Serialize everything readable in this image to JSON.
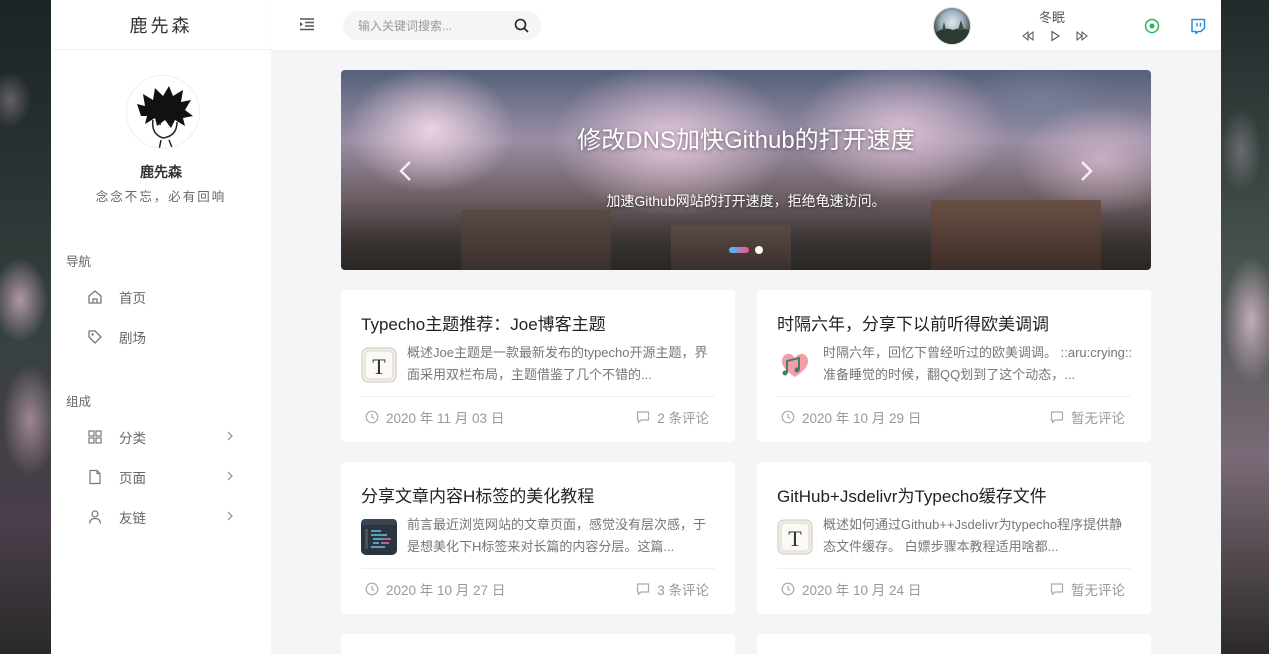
{
  "site": {
    "brand": "鹿先森"
  },
  "profile": {
    "name": "鹿先森",
    "motto": "念念不忘，必有回响"
  },
  "nav": {
    "title": "导航",
    "items": [
      {
        "label": "首页",
        "icon": "home-icon"
      },
      {
        "label": "剧场",
        "icon": "tag-icon"
      }
    ]
  },
  "compose": {
    "title": "组成",
    "items": [
      {
        "label": "分类",
        "icon": "grid-icon"
      },
      {
        "label": "页面",
        "icon": "file-icon"
      },
      {
        "label": "友链",
        "icon": "user-icon"
      }
    ]
  },
  "header": {
    "search_placeholder": "输入关键词搜索...",
    "music_title": "冬眠",
    "colors": {
      "accent_green": "#29b555",
      "accent_blue": "#2a8bd8"
    }
  },
  "banner": {
    "title": "修改DNS加快Github的打开速度",
    "subtitle": "加速Github网站的打开速度，拒绝龟速访问。"
  },
  "posts": [
    {
      "title": "Typecho主题推荐：Joe博客主题",
      "excerpt": "概述Joe主题是一款最新发布的typecho开源主题，界面采用双栏布局，主题借鉴了几个不错的...",
      "date": "2020 年 11 月 03 日",
      "comments": "2 条评论",
      "thumb": "typora-t-icon"
    },
    {
      "title": "时隔六年，分享下以前听得欧美调调",
      "excerpt": "时隔六年，回忆下曾经听过的欧美调调。 ::aru:crying:: 准备睡觉的时候，翻QQ划到了这个动态，...",
      "date": "2020 年 10 月 29 日",
      "comments": "暂无评论",
      "thumb": "music-heart-icon"
    },
    {
      "title": "分享文章内容H标签的美化教程",
      "excerpt": "前言最近浏览网站的文章页面，感觉没有层次感，于是想美化下H标签来对长篇的内容分层。这篇...",
      "date": "2020 年 10 月 27 日",
      "comments": "3 条评论",
      "thumb": "code-editor-icon"
    },
    {
      "title": "GitHub+Jsdelivr为Typecho缓存文件",
      "excerpt": "概述如何通过Github++Jsdelivr为typecho程序提供静态文件缓存。 白嫖步骤本教程适用啥都...",
      "date": "2020 年 10 月 24 日",
      "comments": "暂无评论",
      "thumb": "typora-t-icon"
    }
  ]
}
